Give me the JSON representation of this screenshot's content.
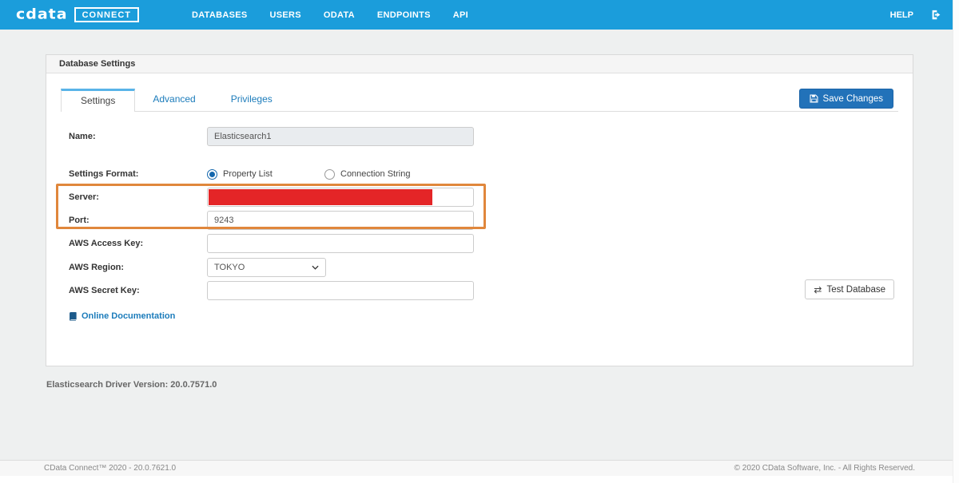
{
  "navbar": {
    "brand": {
      "logo_text": "cdata",
      "badge": "CONNECT"
    },
    "items": [
      {
        "label": "DATABASES"
      },
      {
        "label": "USERS"
      },
      {
        "label": "ODATA"
      },
      {
        "label": "ENDPOINTS"
      },
      {
        "label": "API"
      }
    ],
    "help_label": "HELP"
  },
  "panel": {
    "title": "Database Settings",
    "tabs": [
      {
        "label": "Settings",
        "active": true
      },
      {
        "label": "Advanced",
        "active": false
      },
      {
        "label": "Privileges",
        "active": false
      }
    ],
    "save_button_label": "Save Changes",
    "test_button_label": "Test Database",
    "form": {
      "name": {
        "label": "Name:",
        "value": "Elasticsearch1",
        "disabled": true
      },
      "settings_format": {
        "label": "Settings Format:",
        "options": [
          {
            "label": "Property List",
            "selected": true
          },
          {
            "label": "Connection String",
            "selected": false
          }
        ]
      },
      "server": {
        "label": "Server:",
        "value": "",
        "redacted": true
      },
      "port": {
        "label": "Port:",
        "value": "9243"
      },
      "aws_access_key": {
        "label": "AWS Access Key:",
        "value": ""
      },
      "aws_region": {
        "label": "AWS Region:",
        "value": "TOKYO"
      },
      "aws_secret_key": {
        "label": "AWS Secret Key:",
        "value": ""
      },
      "docs_link_label": "Online Documentation"
    }
  },
  "driver_version": "Elasticsearch Driver Version: 20.0.7571.0",
  "footer": {
    "left": "CData Connect™ 2020 - 20.0.7621.0",
    "right": "© 2020 CData Software, Inc. - All Rights Reserved."
  },
  "icons": {
    "save": "floppy-disk",
    "logout": "sign-out",
    "docs": "book",
    "select_chevron": "chevron-down",
    "test_glyph": "⇄"
  },
  "colors": {
    "navbar_blue": "#1b9ddb",
    "button_blue": "#2272b9",
    "link_blue": "#1c7cbb",
    "active_tab_accent": "#59b4e8",
    "highlight_orange": "#e0873c",
    "redaction_red": "#e42527",
    "page_background": "#eef0f0"
  }
}
